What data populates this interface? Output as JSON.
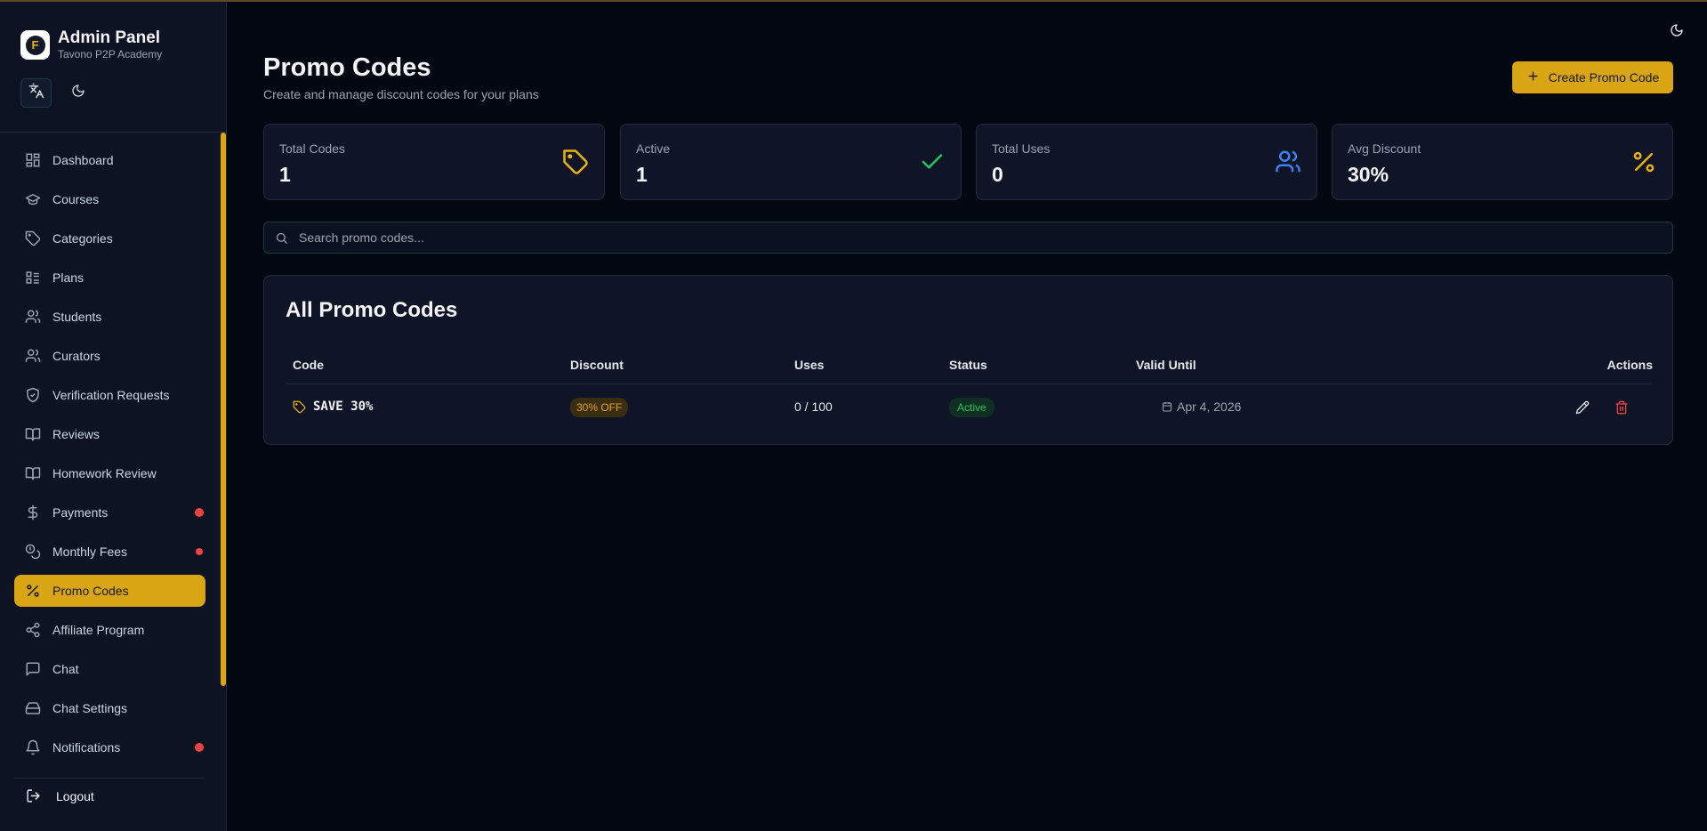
{
  "sidebar": {
    "brand_title": "Admin Panel",
    "brand_subtitle": "Tavono P2P Academy",
    "logo_letter": "F",
    "items": [
      {
        "label": "Dashboard",
        "icon": "dashboard-icon"
      },
      {
        "label": "Courses",
        "icon": "graduation-cap-icon"
      },
      {
        "label": "Categories",
        "icon": "tag-icon"
      },
      {
        "label": "Plans",
        "icon": "list-icon"
      },
      {
        "label": "Students",
        "icon": "users-icon"
      },
      {
        "label": "Curators",
        "icon": "users-icon"
      },
      {
        "label": "Verification Requests",
        "icon": "shield-check-icon"
      },
      {
        "label": "Reviews",
        "icon": "book-open-icon"
      },
      {
        "label": "Homework Review",
        "icon": "book-open-icon"
      },
      {
        "label": "Payments",
        "icon": "dollar-icon",
        "notification": true
      },
      {
        "label": "Monthly Fees",
        "icon": "coins-icon",
        "notification": true
      },
      {
        "label": "Promo Codes",
        "icon": "percent-icon",
        "active": true
      },
      {
        "label": "Affiliate Program",
        "icon": "share-icon"
      },
      {
        "label": "Chat",
        "icon": "message-square-icon"
      },
      {
        "label": "Chat Settings",
        "icon": "hard-drive-icon"
      },
      {
        "label": "Notifications",
        "icon": "bell-icon",
        "notification": true
      }
    ],
    "logout_label": "Logout"
  },
  "header": {
    "title": "Promo Codes",
    "subtitle": "Create and manage discount codes for your plans",
    "create_button": "Create Promo Code"
  },
  "stats": [
    {
      "label": "Total Codes",
      "value": "1",
      "icon": "tag-icon",
      "color": "#eab308"
    },
    {
      "label": "Active",
      "value": "1",
      "icon": "check-icon",
      "color": "#22c55e"
    },
    {
      "label": "Total Uses",
      "value": "0",
      "icon": "users-icon",
      "color": "#3b82f6"
    },
    {
      "label": "Avg Discount",
      "value": "30%",
      "icon": "percent-icon",
      "color": "#eab308"
    }
  ],
  "search": {
    "placeholder": "Search promo codes..."
  },
  "table": {
    "title": "All Promo Codes",
    "columns": [
      "Code",
      "Discount",
      "Uses",
      "Status",
      "Valid Until",
      "Actions"
    ],
    "rows": [
      {
        "code": "SAVE 30%",
        "discount": "30% OFF",
        "uses": "0 / 100",
        "status": "Active",
        "valid_until": "Apr 4, 2026"
      }
    ]
  },
  "colors": {
    "accent": "#d9a514",
    "background": "#030712",
    "danger": "#ef4444",
    "success": "#22c55e"
  }
}
